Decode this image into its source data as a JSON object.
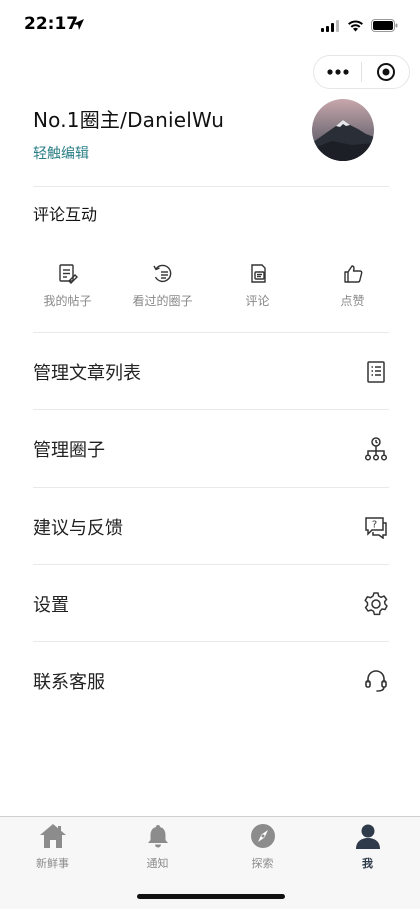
{
  "status": {
    "time": "22:17"
  },
  "profile": {
    "name": "No.1圈主/DanielWu",
    "edit_label": "轻触编辑"
  },
  "section": {
    "title": "评论互动"
  },
  "quick": [
    {
      "label": "我的帖子",
      "icon": "my-posts-icon"
    },
    {
      "label": "看过的圈子",
      "icon": "history-icon"
    },
    {
      "label": "评论",
      "icon": "comment-icon"
    },
    {
      "label": "点赞",
      "icon": "like-icon"
    }
  ],
  "menu": [
    {
      "label": "管理文章列表",
      "icon": "article-list-icon"
    },
    {
      "label": "管理圈子",
      "icon": "org-tree-icon"
    },
    {
      "label": "建议与反馈",
      "icon": "feedback-icon"
    },
    {
      "label": "设置",
      "icon": "gear-icon"
    },
    {
      "label": "联系客服",
      "icon": "headset-icon"
    }
  ],
  "tabbar": [
    {
      "label": "新鲜事",
      "icon": "home-icon",
      "active": false
    },
    {
      "label": "通知",
      "icon": "bell-icon",
      "active": false
    },
    {
      "label": "探索",
      "icon": "compass-icon",
      "active": false
    },
    {
      "label": "我",
      "icon": "user-icon",
      "active": true
    }
  ],
  "colors": {
    "accent": "#2a7f86",
    "active_tab": "#2f3a4a",
    "inactive_tab": "#8c8c8c"
  }
}
